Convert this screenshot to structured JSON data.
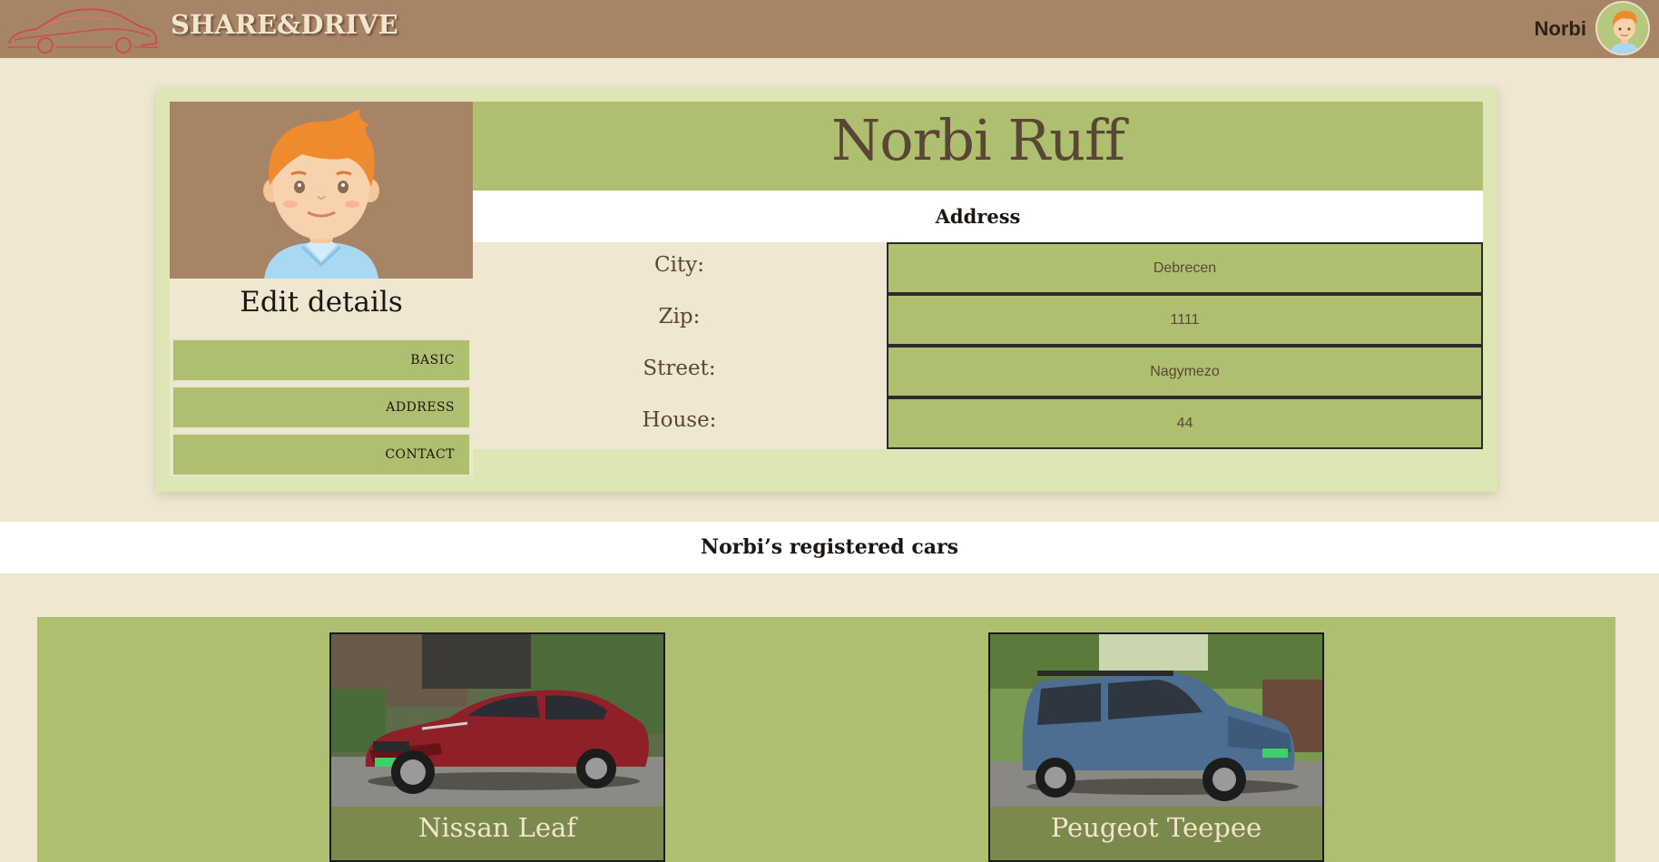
{
  "header": {
    "brand": "SHARE&DRIVE",
    "user_name": "Norbi"
  },
  "profile": {
    "full_name": "Norbi Ruff",
    "edit_title": "Edit details",
    "edit_buttons": [
      "BASIC",
      "ADDRESS",
      "CONTACT"
    ],
    "section_title": "Address",
    "address": [
      {
        "label": "City:",
        "value": "Debrecen"
      },
      {
        "label": "Zip:",
        "value": "1111"
      },
      {
        "label": "Street:",
        "value": "Nagymezo"
      },
      {
        "label": "House:",
        "value": "44"
      }
    ]
  },
  "cars": {
    "title": "Norbi’s registered cars",
    "items": [
      {
        "name": "Nissan Leaf"
      },
      {
        "name": "Peugeot Teepee"
      }
    ]
  },
  "colors": {
    "header_bg": "#a88466",
    "page_bg": "#efe7d1",
    "accent_green": "#aec06f",
    "dark_green": "#7a8a4c"
  }
}
